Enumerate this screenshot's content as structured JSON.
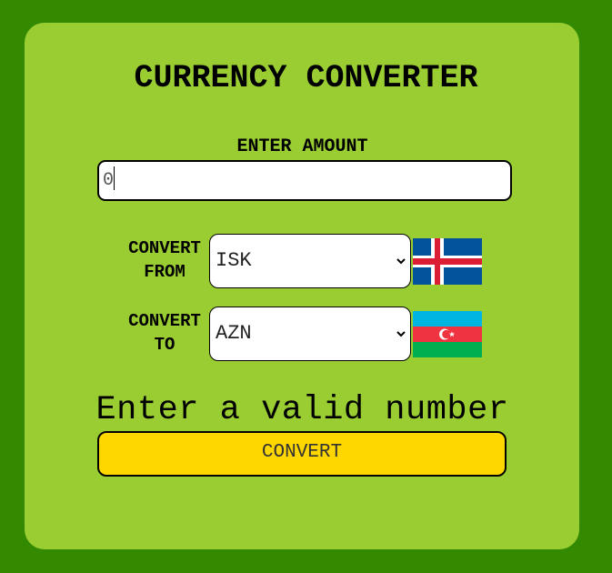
{
  "title": "CURRENCY CONVERTER",
  "amount": {
    "label": "ENTER AMOUNT",
    "value": "0"
  },
  "convert_from": {
    "label_line1": "CONVERT",
    "label_line2": "FROM",
    "selected": "ISK",
    "flag_icon": "iceland-flag-icon"
  },
  "convert_to": {
    "label_line1": "CONVERT",
    "label_line2": "TO",
    "selected": "AZN",
    "flag_icon": "azerbaijan-flag-icon"
  },
  "error_message": "Enter a valid number",
  "convert_button_label": "CONVERT",
  "colors": {
    "page_background": "#338a00",
    "card_background": "#9acd32",
    "button_background": "#ffd700"
  }
}
